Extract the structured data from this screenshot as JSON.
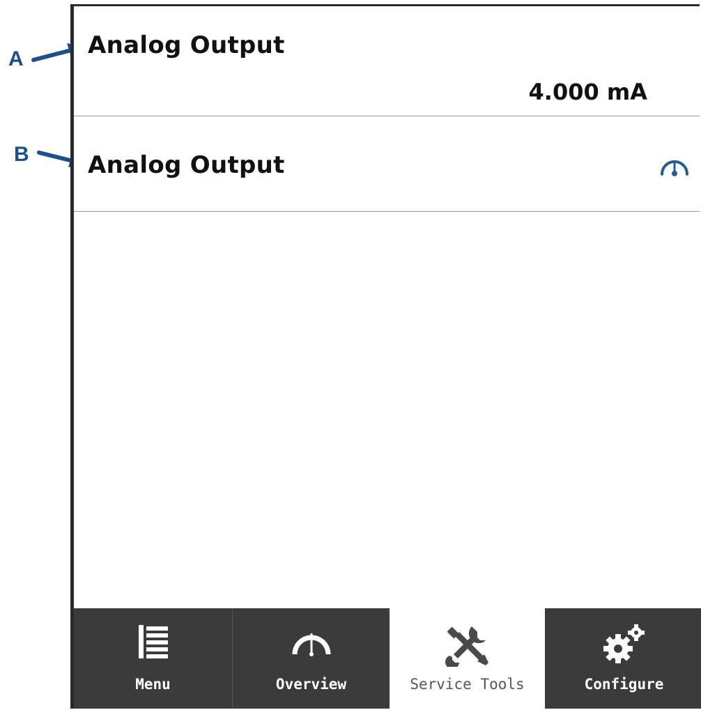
{
  "callouts": {
    "a": "A",
    "b": "B"
  },
  "rows": [
    {
      "title": "Analog Output",
      "value": "4.000 mA"
    },
    {
      "title": "Analog Output",
      "icon": "gauge-icon"
    }
  ],
  "tabs": [
    {
      "label": "Menu",
      "icon": "menu-list-icon",
      "active": false
    },
    {
      "label": "Overview",
      "icon": "gauge-icon",
      "active": false
    },
    {
      "label": "Service Tools",
      "icon": "wrench-screwdriver-icon",
      "active": true
    },
    {
      "label": "Configure",
      "icon": "gears-icon",
      "active": false
    }
  ],
  "colors": {
    "callout": "#1f4e8c",
    "tab_bar": "#3b3b3b",
    "active_tab": "#ffffff",
    "gauge_accent": "#1f5f8f"
  }
}
